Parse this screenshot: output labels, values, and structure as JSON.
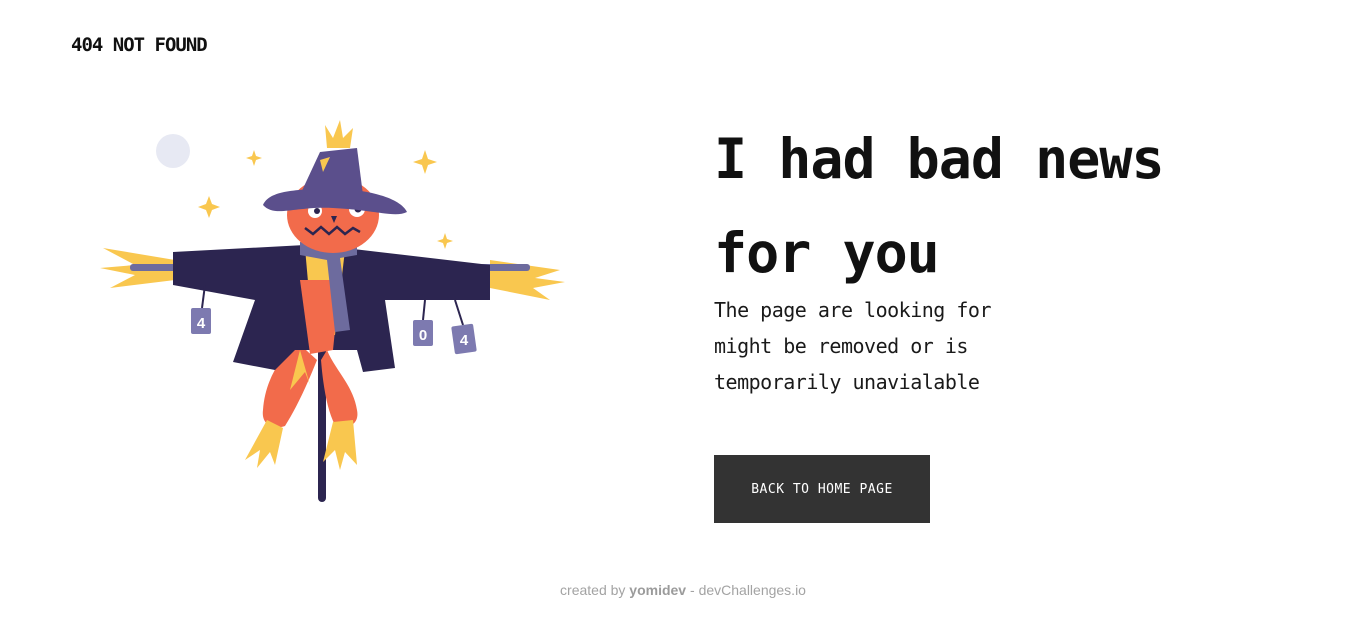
{
  "header": {
    "brand": "404 NOT FOUND"
  },
  "illustration": {
    "name": "scarecrow",
    "can_labels": [
      "4",
      "0",
      "4"
    ],
    "colors": {
      "hat": "#5b4f8c",
      "head": "#f26b4b",
      "coat": "#2c2550",
      "straw": "#f9c74f",
      "scarf": "#6d6b9e",
      "pants": "#f26b4b",
      "moon": "#e7e9f3",
      "pole": "#2c2550"
    }
  },
  "main": {
    "headline": "I had bad news for you",
    "message": "The page are looking for might be removed or is temporarily unavialable",
    "button_label": "BACK TO HOME PAGE"
  },
  "footer": {
    "prefix": "created by",
    "author": "yomidev",
    "separator": "-",
    "site": "devChallenges.io"
  },
  "colors": {
    "button_bg": "#333333",
    "text": "#111111",
    "footer_text": "#a3a3a3"
  }
}
